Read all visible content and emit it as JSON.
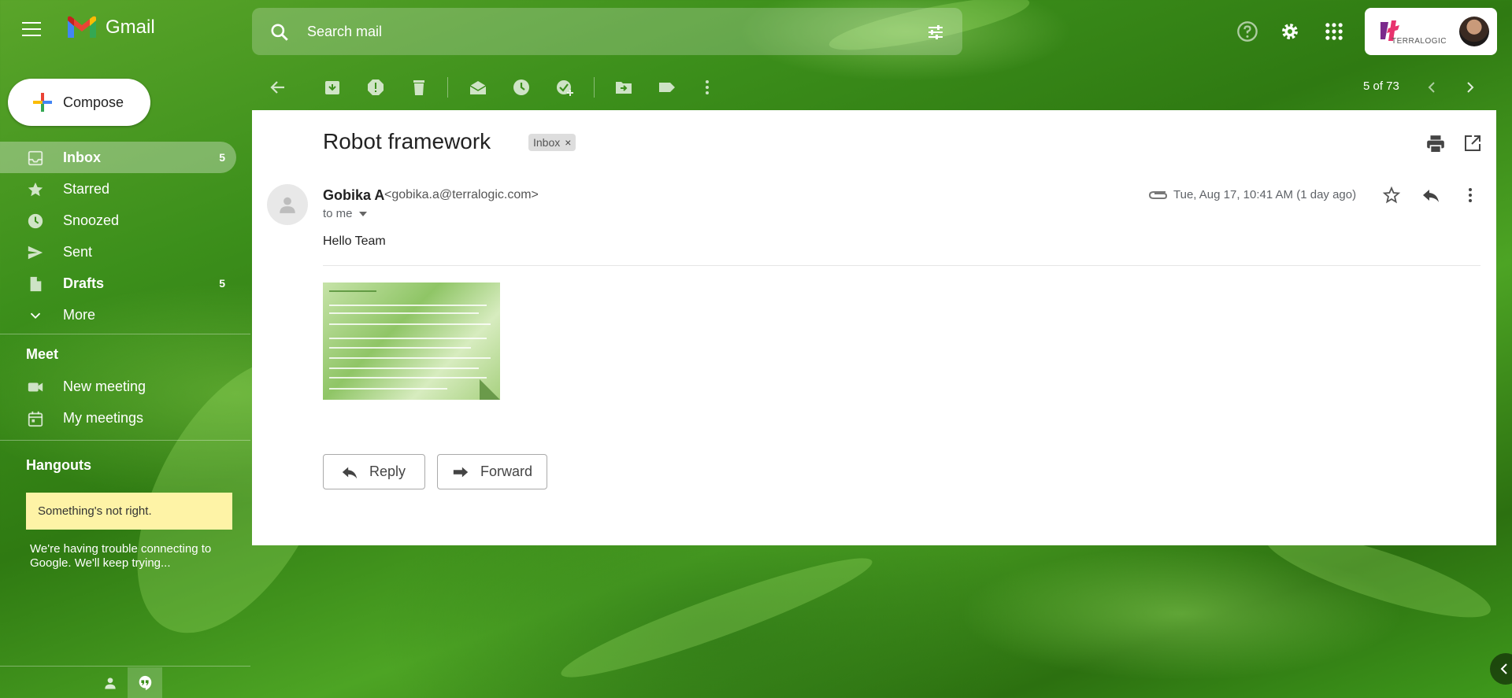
{
  "app": {
    "name": "Gmail"
  },
  "search": {
    "placeholder": "Search mail"
  },
  "account": {
    "org_name": "TERRALOGIC"
  },
  "compose": {
    "label": "Compose"
  },
  "nav": {
    "items": [
      {
        "label": "Inbox",
        "count": "5",
        "icon": "inbox-icon"
      },
      {
        "label": "Starred",
        "count": "",
        "icon": "star-icon"
      },
      {
        "label": "Snoozed",
        "count": "",
        "icon": "clock-icon"
      },
      {
        "label": "Sent",
        "count": "",
        "icon": "send-icon"
      },
      {
        "label": "Drafts",
        "count": "5",
        "icon": "draft-icon"
      },
      {
        "label": "More",
        "count": "",
        "icon": "chevron-down-icon"
      }
    ]
  },
  "meet": {
    "title": "Meet",
    "items": [
      {
        "label": "New meeting",
        "icon": "video-icon"
      },
      {
        "label": "My meetings",
        "icon": "calendar-icon"
      }
    ]
  },
  "hangouts": {
    "title": "Hangouts",
    "alert_title": "Something's not right.",
    "alert_message": "We're having trouble connecting to Google. We'll keep trying..."
  },
  "toolbar": {
    "pager": "5 of 73"
  },
  "message": {
    "subject": "Robot framework",
    "label": "Inbox",
    "label_remove": "×",
    "sender_name": "Gobika A",
    "sender_email": "<gobika.a@terralogic.com>",
    "recipient": "to me",
    "date": "Tue, Aug 17, 10:41 AM (1 day ago)",
    "body": "Hello Team"
  },
  "actions": {
    "reply": "Reply",
    "forward": "Forward"
  },
  "colors": {
    "accent_white": "#ffffff",
    "alert_bg": "#fef3a6",
    "gmail_red": "#EA4335",
    "gmail_blue": "#4285F4",
    "gmail_green": "#34A853",
    "gmail_yellow": "#FBBC04"
  }
}
